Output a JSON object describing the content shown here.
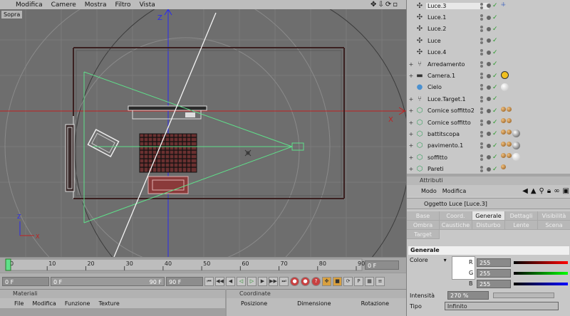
{
  "viewport_menu": [
    "Modifica",
    "Camere",
    "Mostra",
    "Filtro",
    "Vista"
  ],
  "viewport_icons": [
    "move-icon",
    "arrow-down-icon",
    "rotate-icon",
    "maximize-icon"
  ],
  "viewport_label": "Sopra",
  "axes": {
    "z": "Z",
    "x": "X"
  },
  "timeline": {
    "ticks": [
      "0",
      "10",
      "20",
      "30",
      "40",
      "50",
      "60",
      "70",
      "80",
      "90"
    ],
    "current_frame": "0 F",
    "playhead": 0,
    "max": 90
  },
  "transport": {
    "start_field": "0 F",
    "range_start": "0 F",
    "range_end": "90 F",
    "end_field": "90 F"
  },
  "materials": {
    "header": "Materiali",
    "menu": [
      "File",
      "Modifica",
      "Funzione",
      "Texture"
    ]
  },
  "coordinates": {
    "header": "Coordinate",
    "columns": [
      "Posizione",
      "Dimensione",
      "Rotazione"
    ]
  },
  "objects": [
    {
      "name": "Luce.3",
      "icon": "light-icon",
      "selected": true,
      "expand": "",
      "tags": [
        "target"
      ]
    },
    {
      "name": "Luce.1",
      "icon": "light-icon",
      "selected": false,
      "expand": "",
      "tags": []
    },
    {
      "name": "Luce.2",
      "icon": "light-icon",
      "selected": false,
      "expand": "",
      "tags": []
    },
    {
      "name": "Luce",
      "icon": "light-icon",
      "selected": false,
      "expand": "",
      "tags": []
    },
    {
      "name": "Luce.4",
      "icon": "light-icon",
      "selected": false,
      "expand": "",
      "tags": []
    },
    {
      "name": "Arredamento",
      "icon": "null-icon",
      "selected": false,
      "expand": "+",
      "tags": []
    },
    {
      "name": "Camera.1",
      "icon": "camera-icon",
      "selected": false,
      "expand": "+",
      "tags": [
        "protect"
      ]
    },
    {
      "name": "Cielo",
      "icon": "sky-icon",
      "selected": false,
      "expand": "",
      "tags": [
        "white"
      ]
    },
    {
      "name": "Luce.Target.1",
      "icon": "null-icon",
      "selected": false,
      "expand": "+",
      "tags": []
    },
    {
      "name": "Cornice soffitto2",
      "icon": "spline-icon",
      "selected": false,
      "expand": "+",
      "tags": [
        "br",
        "br"
      ]
    },
    {
      "name": "Cornice soffitto",
      "icon": "spline-icon",
      "selected": false,
      "expand": "+",
      "tags": [
        "br",
        "br"
      ]
    },
    {
      "name": "battitscopa",
      "icon": "spline-icon",
      "selected": false,
      "expand": "+",
      "tags": [
        "br",
        "br",
        "gr"
      ]
    },
    {
      "name": "pavimento.1",
      "icon": "spline-icon",
      "selected": false,
      "expand": "+",
      "tags": [
        "br",
        "br",
        "gr"
      ]
    },
    {
      "name": "soffitto",
      "icon": "spline-icon",
      "selected": false,
      "expand": "+",
      "tags": [
        "br",
        "br",
        "wh"
      ]
    },
    {
      "name": "Pareti",
      "icon": "spline-icon",
      "selected": false,
      "expand": "+",
      "tags": [
        "br"
      ]
    }
  ],
  "attributes": {
    "header": "Attributi",
    "menu": [
      "Modo",
      "Modifica"
    ],
    "icons": [
      "arrow-left-icon",
      "arrow-up-icon",
      "search-icon",
      "lock-icon",
      "link-icon",
      "new-window-icon"
    ],
    "object_title": "Oggetto Luce [Luce.3]",
    "tabs_row1": [
      "Base",
      "Coord.",
      "Generale",
      "Dettagli",
      "Visibilità"
    ],
    "tabs_row2": [
      "Ombra",
      "Caustiche",
      "Disturbo",
      "Lente",
      "Scena"
    ],
    "tabs_row3": [
      "Target"
    ],
    "active_tab": "Generale",
    "section": "Generale",
    "color_label": "Colore",
    "r_label": "R",
    "g_label": "G",
    "b_label": "B",
    "r_value": "255",
    "g_value": "255",
    "b_value": "255",
    "intensity_label": "Intensità",
    "intensity_value": "270 %",
    "type_label": "Tipo",
    "type_value": "Infinito"
  },
  "colors": {
    "light_cone": "#5fe08a",
    "axis_z": "#2a2af0",
    "axis_x": "#c02020",
    "check": "#2a9a2a"
  }
}
